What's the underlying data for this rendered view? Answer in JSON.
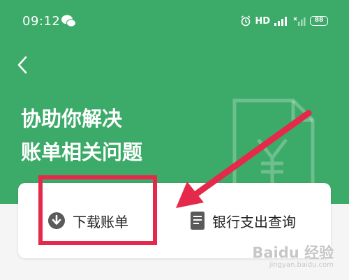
{
  "status_bar": {
    "time": "09:12",
    "network": "HD",
    "battery": "88"
  },
  "headline": {
    "line1": "协助你解决",
    "line2": "账单相关问题"
  },
  "actions": {
    "download_label": "下载账单",
    "query_label": "银行支出查询"
  },
  "watermark": {
    "brand": "Baidu 经验",
    "url": "jingyan.baidu.com"
  },
  "colors": {
    "header_green": "#3caa68",
    "highlight_red": "#e5294a",
    "card_background": "#ffffff"
  },
  "icons": {
    "back": "chevron-left-icon",
    "download": "download-circle-icon",
    "query": "document-icon",
    "doc_watermark": "yen-document-icon"
  }
}
